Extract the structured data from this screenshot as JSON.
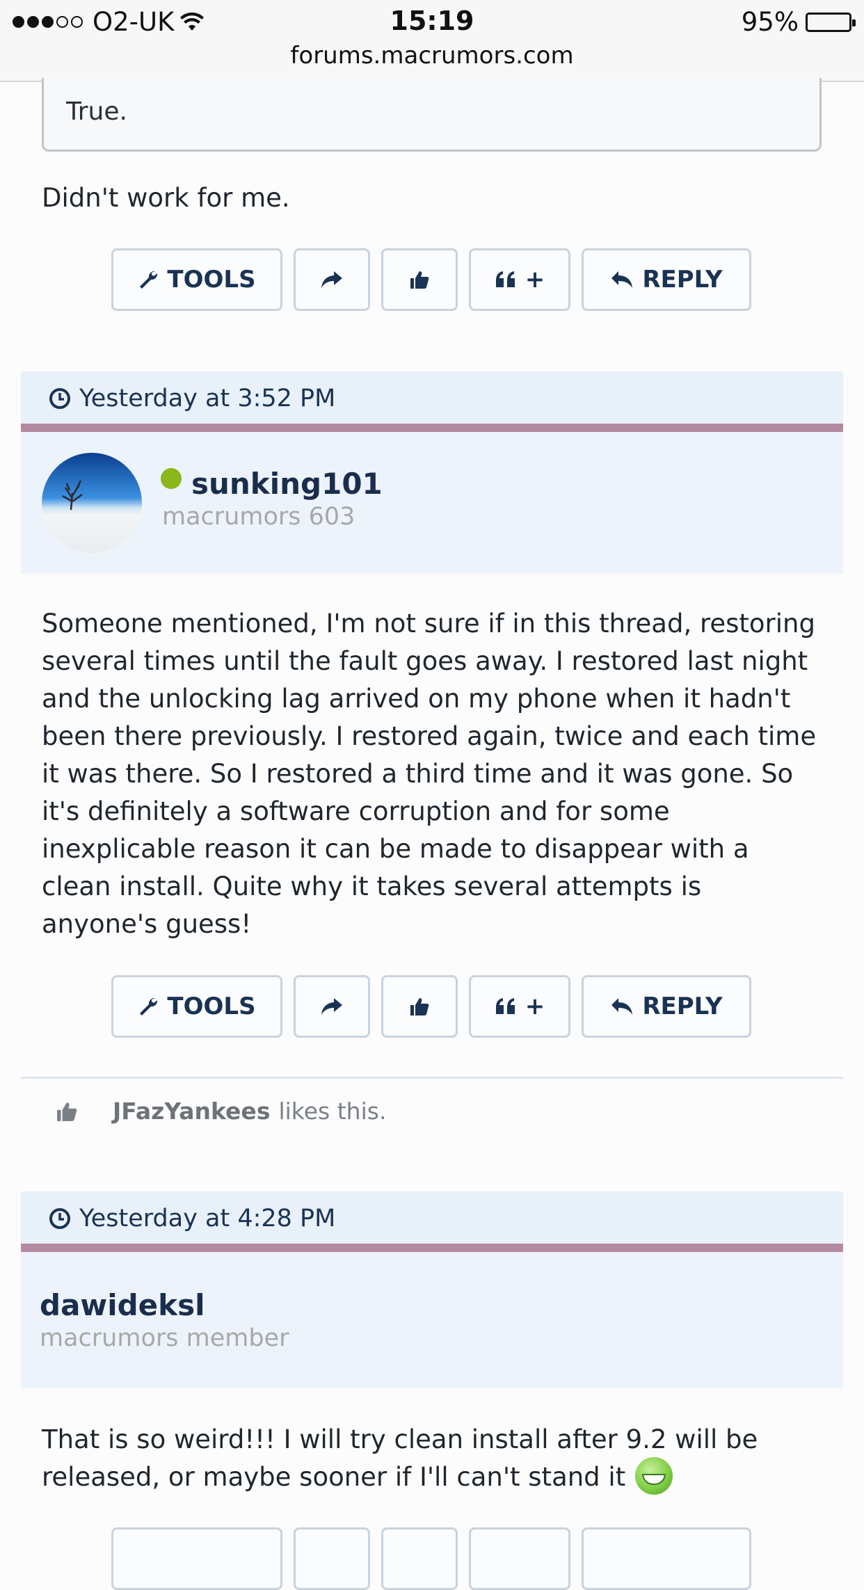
{
  "status_bar": {
    "carrier": "O2-UK",
    "time": "15:19",
    "battery": "95%",
    "url": "forums.macrumors.com",
    "signal_bars_filled": 3,
    "signal_bars_total": 5
  },
  "quoted_text": "True.",
  "posts": [
    {
      "body": "Didn't work for me.",
      "buttons": {
        "tools": "TOOLS",
        "multiquote": "+",
        "reply": "REPLY"
      }
    },
    {
      "date": "Yesterday at 3:52 PM",
      "username": "sunking101",
      "user_title": "macrumors 603",
      "online": true,
      "body": "Someone mentioned, I'm not sure if in this thread, restoring several times until the fault goes away. I restored last night and the unlocking lag arrived on my phone when it hadn't been there previously. I restored again, twice and each time it was there. So I restored a third time and it was gone. So it's definitely a software corruption and for some inexplicable reason it can be made to disappear with a clean install. Quite why it takes several attempts is anyone's guess!",
      "buttons": {
        "tools": "TOOLS",
        "multiquote": "+",
        "reply": "REPLY"
      },
      "likes": {
        "user": "JFazYankees",
        "suffix": "likes this."
      }
    },
    {
      "date": "Yesterday at 4:28 PM",
      "username": "dawideksl",
      "user_title": "macrumors member",
      "body": "That is so weird!!! I will try clean install after 9.2 will be released, or maybe sooner if I'll can't stand it"
    }
  ],
  "colors": {
    "accent_navy": "#1a3354",
    "post_header_bg": "#e8f0f9",
    "separator_mauve": "#b38a9f",
    "online_green": "#8ab81a"
  },
  "icons": [
    "wifi-icon",
    "battery-icon",
    "wrench-icon",
    "share-arrow-icon",
    "thumbs-up-icon",
    "quote-icon",
    "reply-arrow-icon",
    "clock-icon",
    "grin-emoji-icon"
  ]
}
